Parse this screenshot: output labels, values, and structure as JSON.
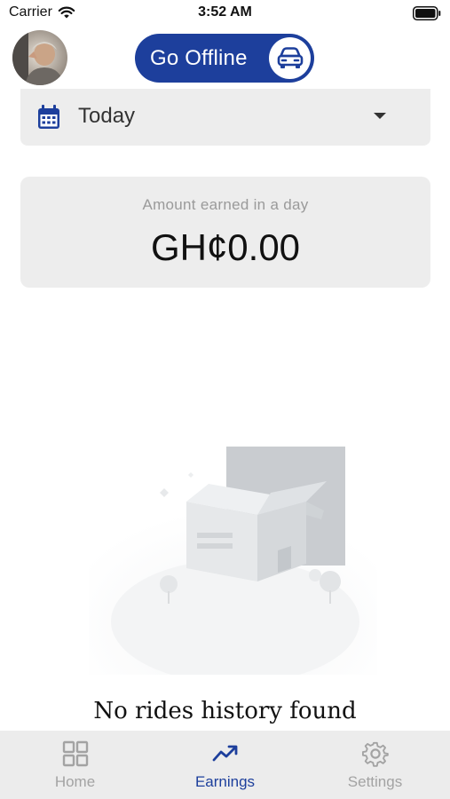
{
  "status_bar": {
    "carrier": "Carrier",
    "time": "3:52 AM"
  },
  "header": {
    "avatar_icon": "user-avatar",
    "toggle_label": "Go Offline",
    "toggle_icon": "car-icon",
    "accent_color": "#1d3f9c"
  },
  "date_filter": {
    "icon": "calendar-icon",
    "selected": "Today"
  },
  "earnings_card": {
    "caption": "Amount earned in a day",
    "amount": "GH¢0.00"
  },
  "empty_state": {
    "illustration": "empty-box-illustration",
    "message": "No rides history found"
  },
  "tabs": [
    {
      "label": "Home",
      "icon": "grid-icon",
      "active": false
    },
    {
      "label": "Earnings",
      "icon": "trending-up-icon",
      "active": true
    },
    {
      "label": "Settings",
      "icon": "gear-icon",
      "active": false
    }
  ]
}
